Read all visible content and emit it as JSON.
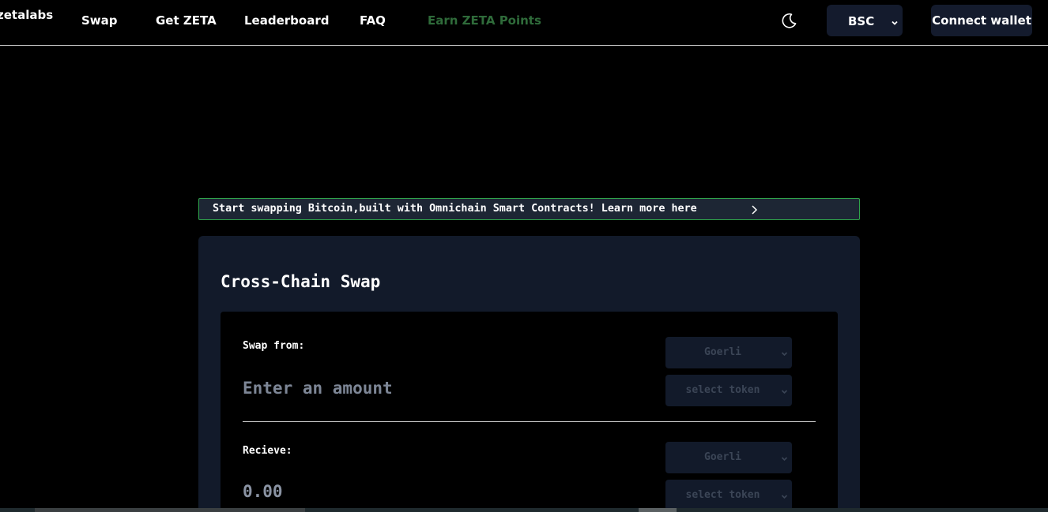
{
  "header": {
    "logo": "zetalabs",
    "nav": {
      "swap": "Swap",
      "get_zeta": "Get ZETA",
      "leaderboard": "Leaderboard",
      "faq": "FAQ",
      "earn": "Earn ZETA Points"
    },
    "theme_icon": "moon-icon",
    "chain_select": "BSC",
    "connect_label": "Connect wallet"
  },
  "banner": {
    "text": "Start swapping Bitcoin,built with Omnichain Smart Contracts! Learn more here",
    "icon": "chevron-right-icon",
    "border_color": "#2fa44a"
  },
  "swap_card": {
    "title": "Cross-Chain Swap",
    "from": {
      "label": "Swap from:",
      "amount_placeholder": "Enter an amount",
      "network": "Goerli",
      "token_placeholder": "select token"
    },
    "to": {
      "label": "Recieve:",
      "amount": "0.00",
      "network": "Goerli",
      "token_placeholder": "select token"
    }
  },
  "colors": {
    "background": "#000000",
    "card": "#121a2a",
    "button": "#141b2d",
    "earn_link": "#2f6b3a"
  }
}
